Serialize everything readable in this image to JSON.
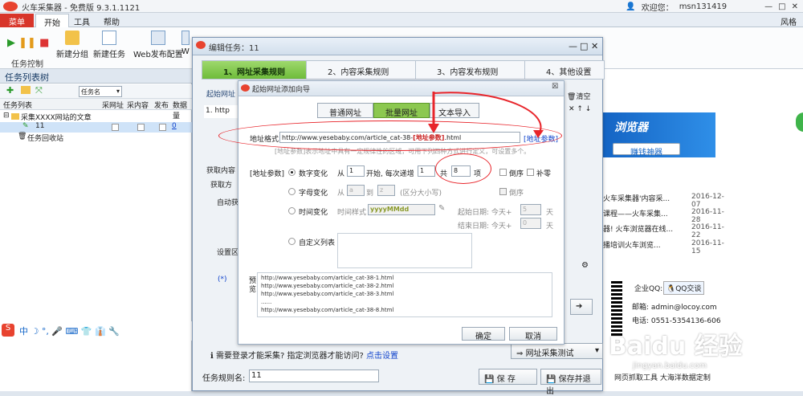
{
  "window": {
    "title": "火车采集器 - 免费版 9.3.1.1121",
    "user_text": "欢迎您：",
    "username": "msn131419",
    "style_label": "风格"
  },
  "ribbon": {
    "tabs": [
      "菜单",
      "开始",
      "工具",
      "帮助"
    ],
    "buttons": [
      "新建分组",
      "新建任务",
      "Web发布配置",
      "W"
    ],
    "group_label": "任务控制"
  },
  "left_panel": {
    "title": "任务列表树",
    "sort_label": "任务名",
    "columns": [
      "任务列表",
      "采网址",
      "采内容",
      "发布",
      "数据量"
    ],
    "tree": [
      {
        "name": "采集XXXX网站的文章"
      },
      {
        "name": "11",
        "count": "0"
      },
      {
        "name": "任务回收站"
      }
    ]
  },
  "dialog": {
    "title": "编辑任务：11",
    "steps": [
      "1、网址采集规则",
      "2、内容采集规则",
      "3、内容发布规则",
      "4、其他设置"
    ],
    "behind_labels": {
      "start_url": "起始网址",
      "url_row": "1. http",
      "get_content": "获取内容",
      "get_method": "获取方",
      "auto": "自动获",
      "settings": "设置区"
    },
    "right_tools": [
      "清空"
    ],
    "login_note": "需要登录才能采集? 指定浏览器才能访问?",
    "login_link": "点击设置",
    "test_button": "网址采集测试",
    "rule_name_label": "任务规则名:",
    "rule_name_value": "11",
    "save": "保 存",
    "save_exit": "保存并退出"
  },
  "wizard": {
    "title": "起始网址添加向导",
    "tabs": [
      "普通网址",
      "批量网址",
      "文本导入"
    ],
    "url_format_label": "地址格式",
    "url_prefix": "http://www.yesebaby.com/article_cat-38-",
    "url_param": "[地址参数]",
    "url_suffix": ".html",
    "param_link": "[地址参数]",
    "hint": "[地址参数]表示地址中具有一定规律性的区域，可用下列四种方式进行定义，可设置多个。",
    "param_section": "[地址参数]",
    "numeric": {
      "label": "数字变化",
      "from": "从",
      "start_val": "1",
      "start_text": "开始, 每次递增",
      "step_val": "1",
      "total_text": "共",
      "total_val": "8",
      "unit": "项",
      "reverse": "倒序",
      "pad": "补零"
    },
    "alpha": {
      "label": "字母变化",
      "from": "从",
      "a": "a",
      "to": "到",
      "z": "z",
      "case_note": "(区分大小写)",
      "reverse": "倒序"
    },
    "time": {
      "label": "时间变化",
      "style_label": "时间样式",
      "style_val": "yyyyMMdd",
      "start_label": "起始日期: 今天+",
      "start_val": "5",
      "end_label": "结束日期: 今天+",
      "end_val": "0",
      "day": "天"
    },
    "custom": {
      "label": "自定义列表"
    },
    "preview_label": "预览",
    "preview": [
      "http://www.yesebaby.com/article_cat-38-1.html",
      "http://www.yesebaby.com/article_cat-38-2.html",
      "http://www.yesebaby.com/article_cat-38-3.html",
      "......",
      "http://www.yesebaby.com/article_cat-38-8.html"
    ],
    "ok": "确定",
    "cancel": "取消"
  },
  "right_content": {
    "banner_title": "浏览器",
    "banner_button": "赚钱神器",
    "news": [
      {
        "title": "火车采集器'内容采...",
        "date": "2016-12-07"
      },
      {
        "title": "课程——火车采集...",
        "date": "2016-11-28"
      },
      {
        "title": "器! 火车浏览器在线...",
        "date": "2016-11-22"
      },
      {
        "title": "播培训火车浏览...",
        "date": "2016-11-15"
      }
    ],
    "qq_label": "企业QQ:",
    "qq_btn": "QQ交谈",
    "mail": "邮箱: admin@locoy.com",
    "phone": "电话: 0551-5354136-606",
    "footer": "网页抓取工具    大海洋数据定制"
  },
  "watermark": "Baidu 经验",
  "watermark_url": "jingyan.baidu.com",
  "colors": {
    "accent_green": "#8cc850",
    "annotation_red": "#e8252b",
    "menu_red": "#d8352a"
  }
}
